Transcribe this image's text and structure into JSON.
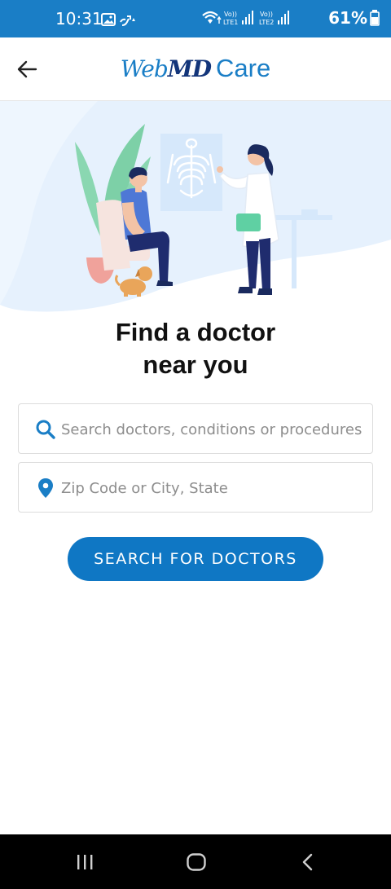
{
  "status_bar": {
    "time": "10:31",
    "battery": "61%"
  },
  "app_bar": {
    "logo_web": "Web",
    "logo_md": "MD",
    "logo_care": "Care"
  },
  "main": {
    "headline_line1": "Find a doctor",
    "headline_line2": "near you",
    "search_placeholder": "Search doctors, conditions or procedures",
    "location_placeholder": "Zip Code or City, State",
    "search_button_label": "SEARCH FOR DOCTORS"
  },
  "colors": {
    "brand_blue": "#1a7ec6",
    "button_blue": "#0f77c4",
    "logo_navy": "#13357a"
  },
  "icons": [
    "image-icon",
    "data-transfer-icon",
    "wifi-icon",
    "signal-icon",
    "battery-icon",
    "back-arrow-icon",
    "search-icon",
    "location-pin-icon",
    "recents-icon",
    "home-icon",
    "nav-back-icon"
  ]
}
